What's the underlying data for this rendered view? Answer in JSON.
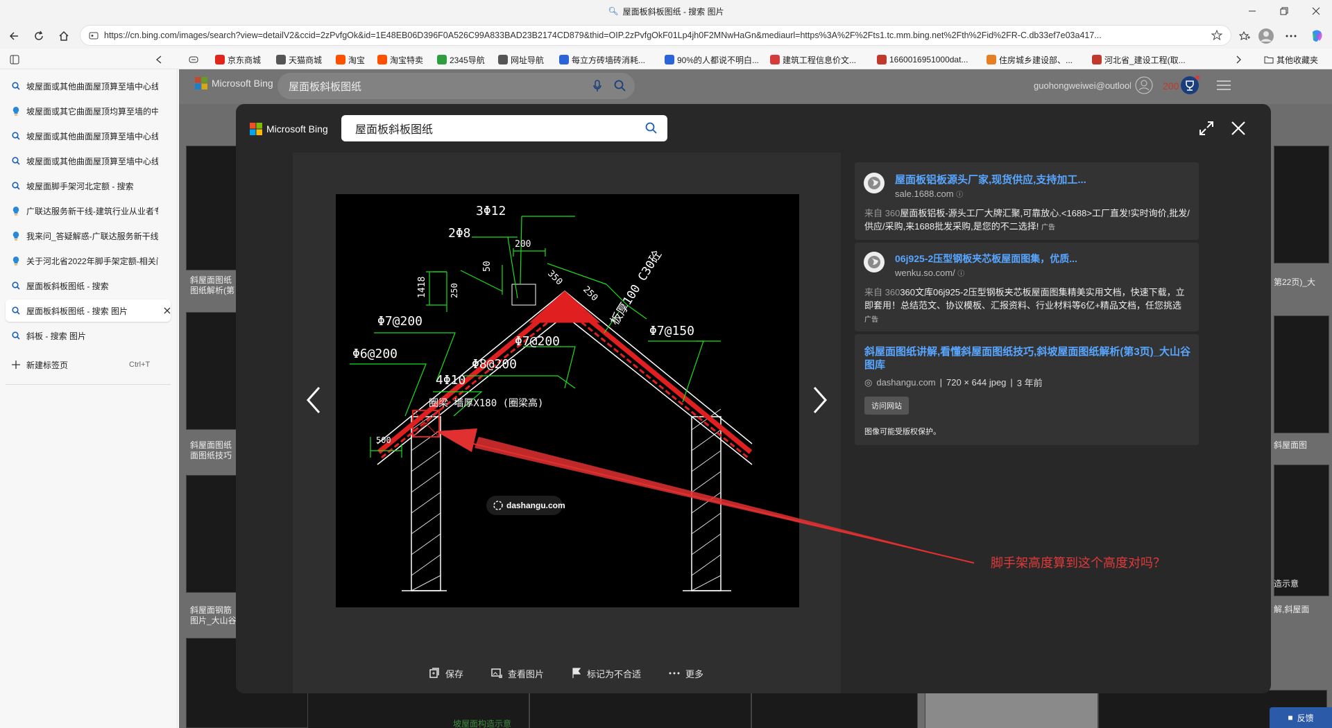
{
  "window": {
    "title": "屋面板斜板图纸 - 搜索 图片",
    "min_icon": "minimize-icon",
    "max_icon": "restore-icon",
    "close_icon": "close-icon"
  },
  "address_bar": {
    "url": "https://cn.bing.com/images/search?view=detailV2&ccid=2zPvfgOk&id=1E48EB06D396F0A526C99A833BAD23B2174CD879&thid=OIP.2zPvfgOkF01Lp4jh0F2MNwHaGn&mediaurl=https%3A%2F%2Fts1.tc.mm.bing.net%2Fth%2Fid%2FR-C.db33ef7e03a417..."
  },
  "bookmarks": [
    {
      "label": "京东商城",
      "color": "#e1251b"
    },
    {
      "label": "天猫商城",
      "color": "#555555"
    },
    {
      "label": "淘宝",
      "color": "#ff5000"
    },
    {
      "label": "淘宝特卖",
      "color": "#ff5000"
    },
    {
      "label": "2345导航",
      "color": "#2f9e3f"
    },
    {
      "label": "网址导航",
      "color": "#555555"
    },
    {
      "label": "每立方砖墙砖消耗...",
      "color": "#2b63d9"
    },
    {
      "label": "90%的人都说不明白...",
      "color": "#2b63d9"
    },
    {
      "label": "建筑工程信息价文...",
      "color": "#d63b3b"
    },
    {
      "label": "1660016951000dat...",
      "color": "#c0392b"
    },
    {
      "label": "住房城乡建设部、...",
      "color": "#e67e22"
    },
    {
      "label": "河北省_建设工程(取...",
      "color": "#c0392b"
    }
  ],
  "other_favorites": "其他收藏夹",
  "tabs": [
    {
      "label": "坡屋面或其他曲面屋顶算至墙中心线",
      "icon": "search-icon",
      "active": false
    },
    {
      "label": "坡屋面或其它曲面屋顶均算至墙的中",
      "icon": "bulb-icon",
      "active": false
    },
    {
      "label": "坡屋面或其他曲面屋顶算至墙中心线",
      "icon": "search-icon",
      "active": false
    },
    {
      "label": "坡屋面或其他曲面屋顶算至墙中心线",
      "icon": "search-icon",
      "active": false
    },
    {
      "label": "坡屋面脚手架河北定额 - 搜索",
      "icon": "search-icon",
      "active": false
    },
    {
      "label": "广联达服务新干线-建筑行业从业者专",
      "icon": "bulb-icon",
      "active": false
    },
    {
      "label": "我来问_答疑解惑-广联达服务新干线",
      "icon": "bulb-icon",
      "active": false
    },
    {
      "label": "关于河北省2022年脚手架定额-相关问",
      "icon": "bulb-icon",
      "active": false
    },
    {
      "label": "屋面板斜板图纸 - 搜索",
      "icon": "search-icon",
      "active": false
    },
    {
      "label": "屋面板斜板图纸 - 搜索 图片",
      "icon": "search-icon",
      "active": true
    },
    {
      "label": "斜板 - 搜索 图片",
      "icon": "search-icon",
      "active": false
    }
  ],
  "new_tab": {
    "label": "新建标签页",
    "shortcut": "Ctrl+T"
  },
  "bing": {
    "brand": "Microsoft Bing",
    "query": "屋面板斜板图纸",
    "account": "guohongweiwei@outlook....",
    "points": "200"
  },
  "background_captions": [
    "斜屋面图纸",
    "图纸解析(第",
    "斜屋面图纸",
    "面图纸技巧",
    "斜屋面钢筋",
    "图片_大山谷",
    "第22页)_大",
    "斜屋面图",
    "造示意",
    "解,斜屋面",
    "坡屋面构造示意"
  ],
  "modal": {
    "brand": "Microsoft Bing",
    "query": "屋面板斜板图纸",
    "watermark": "dashangu.com",
    "actions": [
      "保存",
      "查看图片",
      "标记为不合适",
      "更多"
    ],
    "ads": [
      {
        "title": "屋面板铝板源头厂家,现货供应,支持加工...",
        "domain": "sale.1688.com",
        "from": "来自 360",
        "desc": "屋面板铝板-源头工厂大牌汇聚,可靠放心.<1688>工厂直发!实时询价,批发/供应/采购,来1688批发采购,是您的不二选择!",
        "tag": "广告"
      },
      {
        "title": "06j925-2压型钢板夹芯板屋面图集，优质...",
        "domain": "wenku.so.com/",
        "from": "来自 360",
        "desc": "360文库06j925-2压型钢板夹芯板屋面图集精美实用文档，快速下载，立即套用！总结范文、协议模板、汇报资料、行业材料等6亿+精品文档，任您挑选",
        "tag": "广告"
      }
    ],
    "result": {
      "title": "斜屋面图纸讲解,看懂斜屋面图纸技巧,斜坡屋面图纸解析(第3页)_大山谷图库",
      "domain": "dashangu.com",
      "dims": "720 × 644 jpeg",
      "age": "3 年前",
      "visit": "访问网站",
      "copyright": "图像可能受版权保护。"
    }
  },
  "drawing": {
    "labels": [
      "3Φ12",
      "2Φ8",
      "200",
      "50",
      "350",
      "250",
      "1418",
      "250",
      "Φ7@200",
      "Φ7@200",
      "Φ7@150",
      "Φ6@200",
      "Φ8@200",
      "4Φ10",
      "板厚100 C30砼",
      "圈梁  墙厚X180 (圈梁高)",
      "500"
    ]
  },
  "annotation": "脚手架高度算到这个高度对吗？",
  "feedback": "反馈"
}
